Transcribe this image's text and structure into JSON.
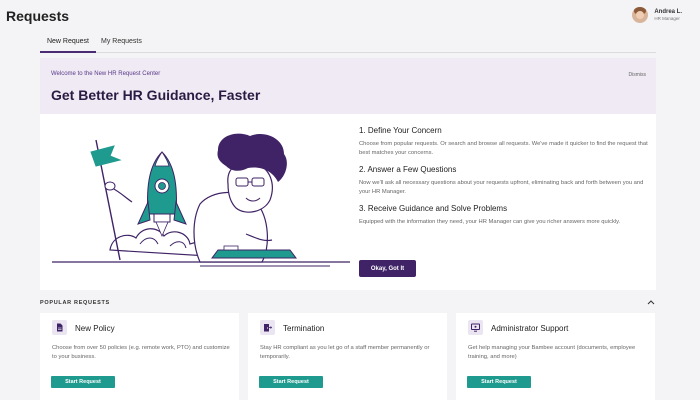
{
  "header": {
    "title": "Requests",
    "user": {
      "name": "Andrea L.",
      "role": "HR Manager"
    }
  },
  "tabs": [
    {
      "label": "New Request",
      "active": true
    },
    {
      "label": "My Requests",
      "active": false
    }
  ],
  "welcome": {
    "subtitle": "Welcome to the New HR Request Center",
    "dismiss_label": "Dismiss",
    "title": "Get Better HR Guidance, Faster"
  },
  "steps": [
    {
      "title": "1. Define Your Concern",
      "text": "Choose from popular requests. Or search and browse all requests. We've made it quicker to find the request that best matches your concerns."
    },
    {
      "title": "2. Answer a Few Questions",
      "text": "Now we'll ask all necessary questions about your requests upfront, eliminating back and forth between you and your HR Manager."
    },
    {
      "title": "3. Receive Guidance and Solve Problems",
      "text": "Equipped with the information they need, your HR Manager can give you richer answers more quickly."
    }
  ],
  "ok_button": "Okay, Got It",
  "popular": {
    "heading": "POPULAR REQUESTS",
    "cards": [
      {
        "icon": "document-icon",
        "title": "New Policy",
        "desc": "Choose from over 50 policies (e.g. remote work, PTO) and customize to your business.",
        "button": "Start Request"
      },
      {
        "icon": "door-exit-icon",
        "title": "Termination",
        "desc": "Stay HR compliant as you let go of a staff member permanently or temporarily.",
        "button": "Start Request"
      },
      {
        "icon": "monitor-icon",
        "title": "Administrator Support",
        "desc": "Get help managing your Bambee account (documents, employee training, and more)",
        "button": "Start Request"
      }
    ]
  },
  "colors": {
    "brand_purple": "#3f2366",
    "teal": "#1f9a8f",
    "welcome_bg": "#efeaf4"
  }
}
